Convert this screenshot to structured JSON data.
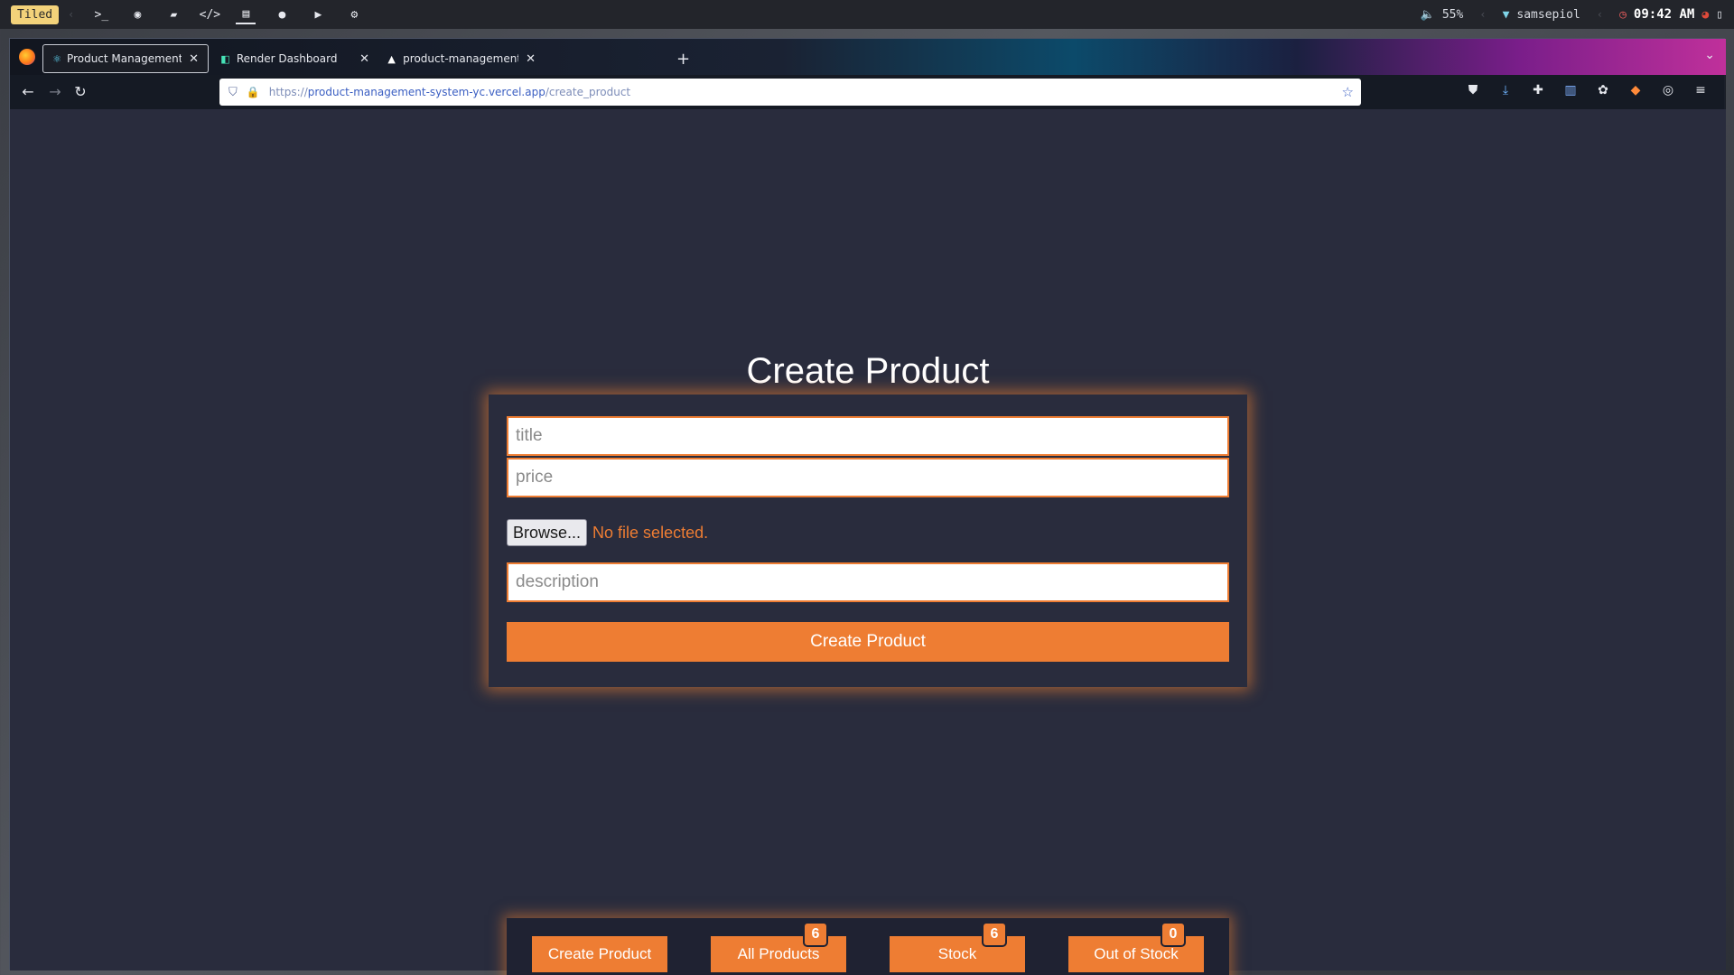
{
  "system_bar": {
    "layout_label": "Tiled",
    "launcher_icons": [
      "terminal-icon",
      "firefox-icon",
      "folder-icon",
      "code-icon",
      "notes-icon",
      "chat-icon",
      "youtube-icon",
      "settings-icon"
    ],
    "volume": "55%",
    "wifi_name": "samsepiol",
    "clock": "09:42 AM"
  },
  "browser": {
    "tabs": [
      {
        "title": "Product Management System",
        "favicon": "react-icon",
        "active": true
      },
      {
        "title": "Render Dashboard",
        "favicon": "render-icon",
        "active": false
      },
      {
        "title": "product-management-system",
        "favicon": "vercel-icon",
        "active": false
      }
    ],
    "url": {
      "protocol": "https://",
      "domain": "product-management-system-yc.vercel.app",
      "path": "/create_product"
    }
  },
  "page": {
    "title": "Create Product",
    "form": {
      "title_placeholder": "title",
      "price_placeholder": "price",
      "browse_label": "Browse...",
      "file_status": "No file selected.",
      "description_placeholder": "description",
      "submit_label": "Create Product"
    },
    "bottom_nav": {
      "create_label": "Create Product",
      "all_label": "All Products",
      "all_count": "6",
      "stock_label": "Stock",
      "stock_count": "6",
      "out_label": "Out of Stock",
      "out_count": "0"
    }
  },
  "colors": {
    "accent": "#ee7d33",
    "background": "#292c3d",
    "nav_background": "#1f2232"
  }
}
